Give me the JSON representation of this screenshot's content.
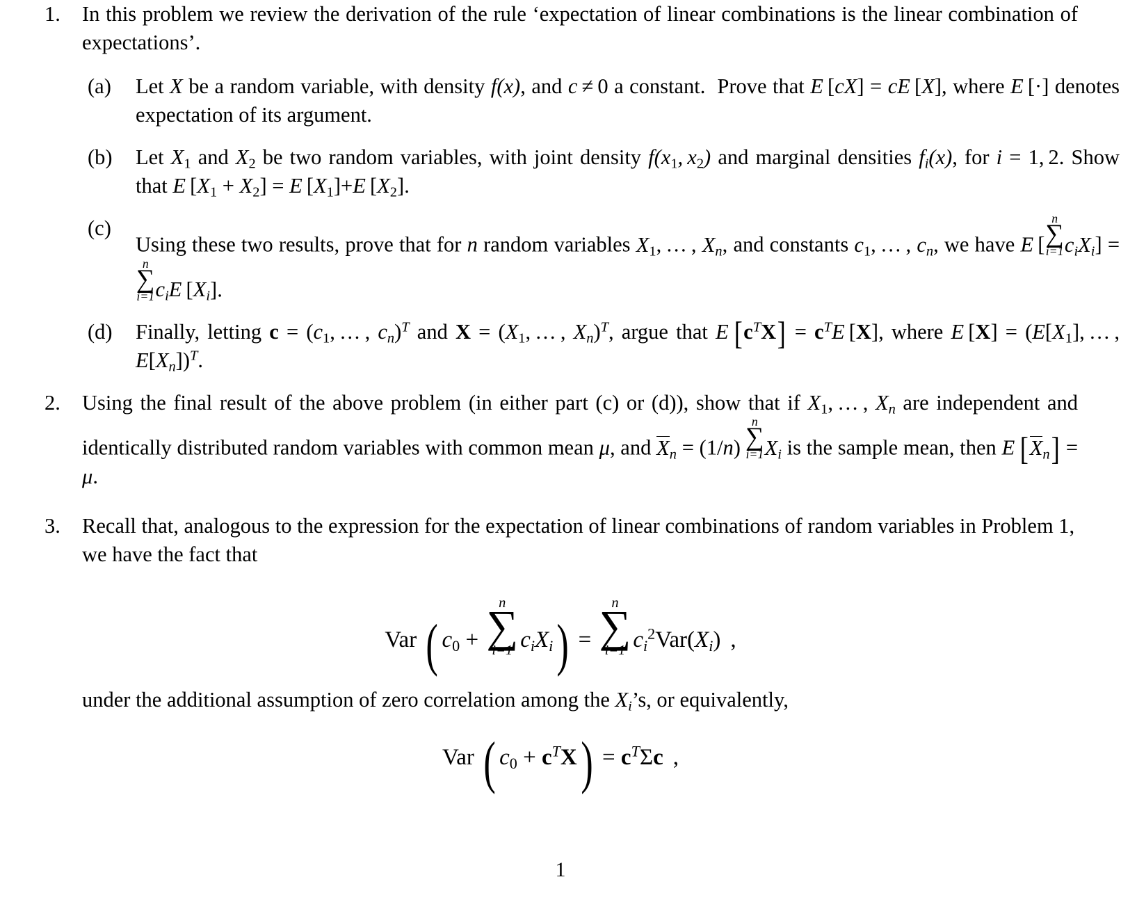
{
  "document": {
    "type": "problem-set",
    "page_number": "1",
    "problems": [
      {
        "marker": "1.",
        "intro": "In this problem we review the derivation of the rule 'expectation of linear combinations is the linear combination of expectations'.",
        "intro_line1": "In this problem we review the derivation of the rule ‘expectation of linear combi-",
        "intro_line2": "nations is the linear combination of expectations’.",
        "subparts": [
          {
            "marker": "(a)",
            "text": "Let X be a random variable, with density f(x), and c ≠ 0 a constant. Prove that E[cX] = cE[X], where E[·] denotes expectation of its argument.",
            "seg": {
              "t1": "Let ",
              "v1": "X",
              "t2": " be a random variable, with density ",
              "f": "f",
              "fx": "(x)",
              "t3": ", and ",
              "c": "c",
              "neq": "≠",
              "zero": "0",
              "t4": " a constant.  Prove that ",
              "E1": "E",
              "cX": "cX",
              "eq": "=",
              "cE": "cE",
              "X": "X",
              "t5": ", where ",
              "E2": "E",
              "dot": "·",
              "t6": " denotes expectation of its argument."
            }
          },
          {
            "marker": "(b)",
            "text": "Let X₁ and X₂ be two random variables, with joint density f(x₁, x₂) and marginal densities fᵢ(x), for i = 1, 2. Show that E[X₁ + X₂] = E[X₁]+E[X₂].",
            "seg": {
              "t1": "Let ",
              "t2": " and ",
              "t3": " be two random variables, with joint density ",
              "t4": " and marginal densities ",
              "t5": ", for ",
              "t6": ". Show that ",
              "i_eq": "i = 1, 2",
              "fjoint": "f(x₁, x₂)"
            }
          },
          {
            "marker": "(c)",
            "text": "Using these two results, prove that for n random variables X₁, …, Xₙ, and constants c₁, …, cₙ, we have E[∑ᵢ₌₁ⁿ cᵢXᵢ] = ∑ᵢ₌₁ⁿ cᵢE[Xᵢ].",
            "seg": {
              "t1": "Using these two results, prove that for ",
              "n": "n",
              "t2": " random variables ",
              "t3": ", and constants ",
              "t4": ", we have "
            }
          },
          {
            "marker": "(d)",
            "text": "Finally, letting c = (c₁, …, cₙ)ᵀ and X = (X₁, …, Xₙ)ᵀ, argue that E[cᵀX] = cᵀE[X], where E[X] = (E[X₁], …, E[Xₙ])ᵀ.",
            "seg": {
              "t1": "Finally, letting ",
              "t2": " and ",
              "t3": ", argue that ",
              "t4": ", where "
            }
          }
        ]
      },
      {
        "marker": "2.",
        "text": "Using the final result of the above problem (in either part (c) or (d)), show that if X₁, …, Xₙ are independent and identically distributed random variables with common mean μ, and X̄ₙ = (1/n) ∑ᵢ₌₁ⁿ Xᵢ is the sample mean, then E[X̄ₙ] = μ.",
        "seg": {
          "t1": "Using the final result of the above problem (in either part (c) or (d)), show that if ",
          "t2": " are independent and identically distributed random variables with common mean ",
          "mu": "μ",
          "t3": ", and ",
          "t4": " is the sample mean, then ",
          "t5": "."
        }
      },
      {
        "marker": "3.",
        "text": "Recall that, analogous to the expression for the expectation of linear combinations of random variables in Problem 1, we have the fact that",
        "trailing_text": "under the additional assumption of zero correlation among the Xᵢ's, or equivalently,",
        "trailing_seg": {
          "t1": "under the additional assumption of zero correlation among the ",
          "t2": "’s, or equivalently,"
        },
        "equations": [
          {
            "id": "var-sum",
            "latex": "Var(c_0 + \\sum_{i=1}^{n} c_i X_i) = \\sum_{i=1}^{n} c_i^2 Var(X_i) ,",
            "plain": "Var ( c₀ + ∑_{i=1}^{n} cᵢXᵢ ) = ∑_{i=1}^{n} cᵢ²Var(Xᵢ) ,",
            "parts": {
              "var": "Var",
              "c0": "c",
              "c0sub": "0",
              "plus": "+",
              "sigma": "∑",
              "lim_top": "n",
              "lim_bot": "i=1",
              "ci": "c",
              "isub": "i",
              "Xi": "X",
              "equals": "=",
              "sq": "2",
              "comma": ","
            }
          },
          {
            "id": "var-quadratic",
            "latex": "Var(c_0 + \\mathbf{c}^T \\mathbf{X}) = \\mathbf{c}^T \\Sigma \\mathbf{c} ,",
            "plain": "Var ( c₀ + cᵀX ) = cᵀΣc ,",
            "parts": {
              "var": "Var",
              "c0": "c",
              "c0sub": "0",
              "plus": "+",
              "cbold": "c",
              "Tsup": "T",
              "Xbold": "X",
              "equals": "=",
              "Sigma": "Σ",
              "comma": ","
            }
          }
        ]
      }
    ],
    "symbols": {
      "E": "E",
      "X": "X",
      "x": "x",
      "f": "f",
      "c": "c",
      "n": "n",
      "i": "i",
      "T": "T",
      "mu": "μ",
      "sigma_sum": "∑",
      "neq": "≠",
      "eq": "=",
      "plus": "+",
      "dot": "·",
      "ldots": "…",
      "one": "1",
      "two": "2",
      "zero": "0"
    }
  }
}
